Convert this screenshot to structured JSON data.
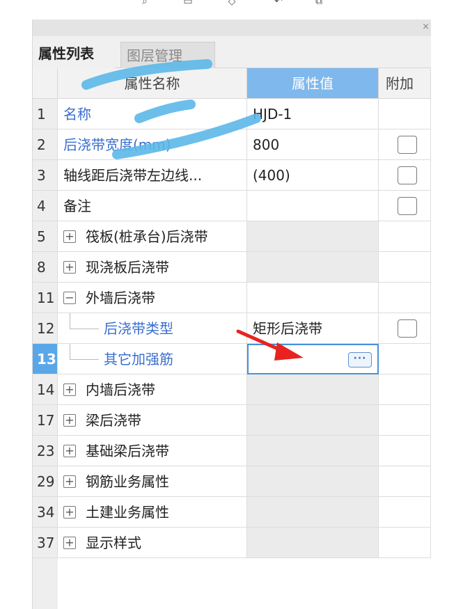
{
  "toolbar": {
    "icons": [
      "search-icon",
      "delete-icon",
      "filter-icon",
      "undo-icon",
      "copy-icon"
    ]
  },
  "panel": {
    "close_glyph": "×",
    "tabs": [
      {
        "label": "属性列表",
        "active": true
      },
      {
        "label": "图层管理",
        "active": false
      }
    ],
    "headers": {
      "name": "属性名称",
      "value": "属性值",
      "extra": "附加"
    },
    "rows": [
      {
        "num": "1",
        "name": "名称",
        "value": "HJD-1",
        "blue": true,
        "checkbox": false
      },
      {
        "num": "2",
        "name": "后浇带宽度(mm)",
        "value": "800",
        "blue": true,
        "checkbox": true
      },
      {
        "num": "3",
        "name": "轴线距后浇带左边线...",
        "value": "(400)",
        "blue": false,
        "checkbox": true
      },
      {
        "num": "4",
        "name": "备注",
        "value": "",
        "blue": false,
        "checkbox": true
      },
      {
        "num": "5",
        "name": "筏板(桩承台)后浇带",
        "value": "",
        "expander": "+",
        "gray": true
      },
      {
        "num": "8",
        "name": "现浇板后浇带",
        "value": "",
        "expander": "+",
        "gray": true
      },
      {
        "num": "11",
        "name": "外墙后浇带",
        "value": "",
        "expander": "−",
        "gray": false
      },
      {
        "num": "12",
        "name": "后浇带类型",
        "value": "矩形后浇带",
        "blue": true,
        "child": true,
        "checkbox": true
      },
      {
        "num": "13",
        "name": "其它加强筋",
        "value": "",
        "blue": true,
        "child": true,
        "editing": true,
        "selected": true
      },
      {
        "num": "14",
        "name": "内墙后浇带",
        "value": "",
        "expander": "+",
        "gray": true
      },
      {
        "num": "17",
        "name": "梁后浇带",
        "value": "",
        "expander": "+",
        "gray": true
      },
      {
        "num": "23",
        "name": "基础梁后浇带",
        "value": "",
        "expander": "+",
        "gray": true
      },
      {
        "num": "29",
        "name": "钢筋业务属性",
        "value": "",
        "expander": "+",
        "gray": true
      },
      {
        "num": "34",
        "name": "土建业务属性",
        "value": "",
        "expander": "+",
        "gray": true
      },
      {
        "num": "37",
        "name": "显示样式",
        "value": "",
        "expander": "+",
        "gray": true
      }
    ],
    "ellipsis": "···"
  },
  "colors": {
    "accent": "#7fb8ec",
    "link_blue": "#3a6fd0",
    "annotation_arrow": "#e8231f",
    "scribble": "#5bb8e8"
  }
}
